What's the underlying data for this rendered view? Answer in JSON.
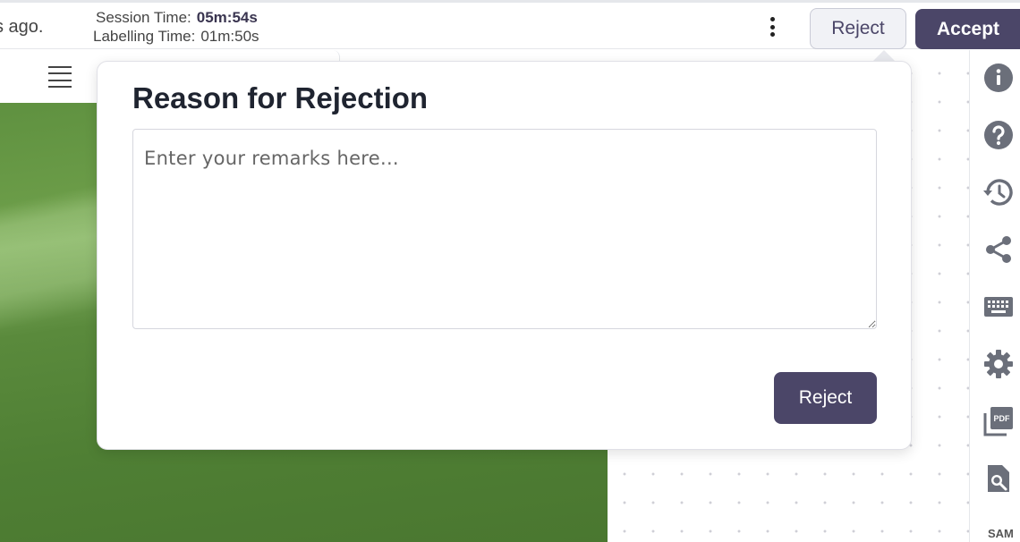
{
  "header": {
    "saved_ago": "s ago.",
    "session_time_label": "Session Time:",
    "session_time_value": "05m:54s",
    "labelling_time_label": "Labelling Time:",
    "labelling_time_value": "01m:50s",
    "reject_label": "Reject",
    "accept_label": "Accept"
  },
  "popover": {
    "title": "Reason for Rejection",
    "remarks_placeholder": "Enter your remarks here...",
    "remarks_value": "",
    "reject_label": "Reject"
  },
  "sidebar": {
    "items": [
      {
        "icon": "info-icon"
      },
      {
        "icon": "help-icon"
      },
      {
        "icon": "history-icon"
      },
      {
        "icon": "share-icon"
      },
      {
        "icon": "keyboard-icon"
      },
      {
        "icon": "settings-icon"
      },
      {
        "icon": "pdf-icon"
      },
      {
        "icon": "document-search-icon"
      }
    ],
    "sam_label": "SAM"
  },
  "colors": {
    "primary": "#4b4668",
    "icon_gray": "#6b6f7a"
  }
}
